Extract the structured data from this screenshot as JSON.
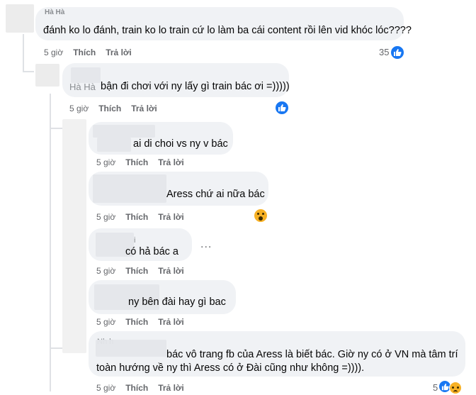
{
  "actions": {
    "time": "5 giờ",
    "like": "Thích",
    "reply": "Trả lời"
  },
  "comments": [
    {
      "name_partial": "Hà Hà",
      "text": "đánh ko lo đánh, train ko lo train cứ lo làm ba cái content rồi lên vid khóc lóc????",
      "reactions": "35"
    },
    {
      "name_partial": "Hà Hà",
      "text": "bận đi chơi với ny lấy gì train bác ơi =)))))"
    },
    {
      "text": "ai di choi vs ny v bác"
    },
    {
      "text": "Aress chứ ai nữa bác"
    },
    {
      "name_partial": "i",
      "text": "có hả bác a",
      "more": "..."
    },
    {
      "text": "ny bên đài hay gì bac"
    },
    {
      "name_partial": "Nh     h",
      "line1": "bác vô trang fb của Aress là biết bác. Giờ ny có ở VN mà tâm trí",
      "line2": "toàn hướng về ny thì Aress có ở Đài cũng như không =)))).",
      "reactions": "5"
    }
  ],
  "colors": {
    "bubble": "#f0f2f5",
    "meta": "#65676b",
    "like_blue": "#1877f2",
    "wow_yellow": "#f7b125"
  },
  "icons": [
    "like-reaction-icon",
    "wow-reaction-icon",
    "sad-reaction-icon",
    "more-options-icon"
  ]
}
